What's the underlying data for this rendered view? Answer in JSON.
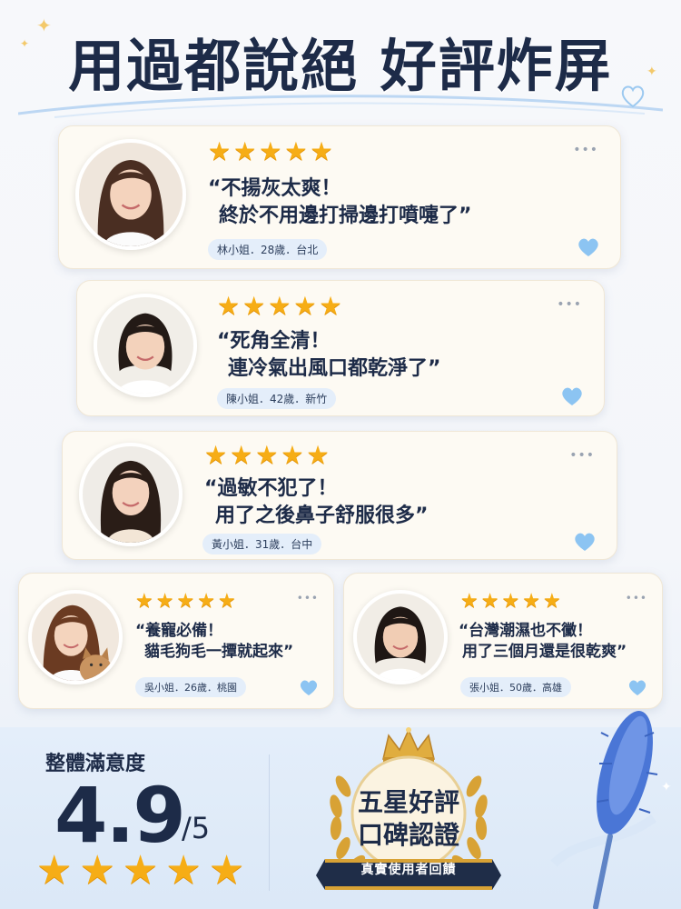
{
  "header": {
    "title": "用過都說絕 好評炸屏"
  },
  "reviews": [
    {
      "quote_line1": "“不揚灰太爽！",
      "quote_line2": "終於不用邊打掃邊打噴嚏了”",
      "tag": "林小姐．28歲．台北",
      "rating": 5
    },
    {
      "quote_line1": "“死角全清！",
      "quote_line2": "連冷氣出風口都乾淨了”",
      "tag": "陳小姐．42歲．新竹",
      "rating": 5
    },
    {
      "quote_line1": "“過敏不犯了！",
      "quote_line2": "用了之後鼻子舒服很多”",
      "tag": "黃小姐．31歲．台中",
      "rating": 5
    },
    {
      "quote_line1": "“養寵必備！",
      "quote_line2": "貓毛狗毛一撢就起來”",
      "tag": "吳小姐．26歲．桃園",
      "rating": 5
    },
    {
      "quote_line1": "“台灣潮濕也不黴！",
      "quote_line2": "用了三個月還是很乾爽”",
      "tag": "張小姐．50歲．高雄",
      "rating": 5
    }
  ],
  "summary": {
    "label": "整體滿意度",
    "score": "4.9",
    "denominator": "/5",
    "rating": 5
  },
  "badge": {
    "line1": "五星好評",
    "line2": "口碑認證",
    "ribbon": "真實使用者回饋"
  },
  "colors": {
    "star": "#f6ad16",
    "heart": "#8cc4f2",
    "tag_bg": "#e4eefa",
    "card_bg": "#fdfaf3",
    "title": "#1d2b48",
    "gold": "#d8a235"
  },
  "icons": [
    "star-icon",
    "heart-icon",
    "more-dots-icon",
    "crown-icon",
    "laurel-icon",
    "duster-icon"
  ]
}
